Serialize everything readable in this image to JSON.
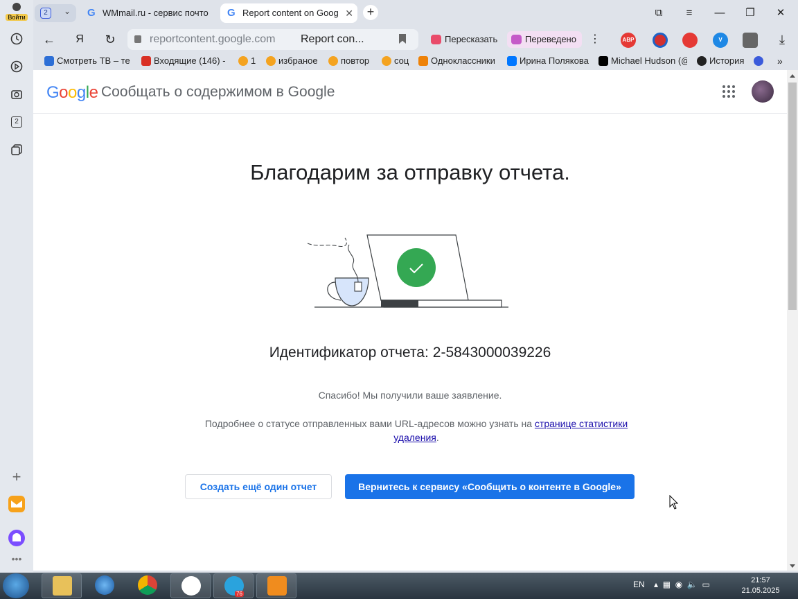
{
  "sidebar": {
    "login_label": "Войти",
    "tab_counter": "2"
  },
  "tabs": [
    {
      "title": "WMmail.ru - сервис почто",
      "active": false
    },
    {
      "title": "Report content on Goog",
      "active": true
    }
  ],
  "tab_counter": "2",
  "address": {
    "url": "reportcontent.google.com",
    "page_title": "Report con..."
  },
  "toolbar": {
    "retell_label": "Пересказать",
    "translated_label": "Переведено",
    "abp_label": "ABP"
  },
  "bookmarks": [
    {
      "label": "Смотреть ТВ – те",
      "color": "#2d6fd6"
    },
    {
      "label": "Входящие (146) -",
      "color": "#d93025"
    },
    {
      "label": "1",
      "color": "#f4a320"
    },
    {
      "label": "избраное",
      "color": "#f4a320"
    },
    {
      "label": "повтор",
      "color": "#f4a320"
    },
    {
      "label": "соц",
      "color": "#f4a320"
    },
    {
      "label": "Одноклассники",
      "color": "#ee8208"
    },
    {
      "label": "Ирина Полякова",
      "color": "#0077ff"
    },
    {
      "label": "Michael Hudson (@",
      "color": "#000000"
    },
    {
      "label": "История",
      "color": "#222222"
    }
  ],
  "header": {
    "logo": "Google",
    "title": "Сообщать о содержимом в Google"
  },
  "main": {
    "heading": "Благодарим за отправку отчета.",
    "report_id_label": "Идентификатор отчета:",
    "report_id_value": "2-5843000039226",
    "received_text": "Спасибо! Мы получили ваше заявление.",
    "status_prefix": "Подробнее о статусе отправленных вами URL-адресов можно узнать на ",
    "status_link": "странице статистики удаления",
    "status_suffix": ".",
    "btn_another": "Создать ещё один отчет",
    "btn_return": "Вернитесь к сервису «Сообщить о контенте в Google»"
  },
  "taskbar": {
    "lang": "EN",
    "telegram_badge": "76",
    "time": "21:57",
    "date": "21.05.2025"
  },
  "colors": {
    "accent": "#1a73e8",
    "success": "#34a853",
    "link": "#1a0dab"
  }
}
